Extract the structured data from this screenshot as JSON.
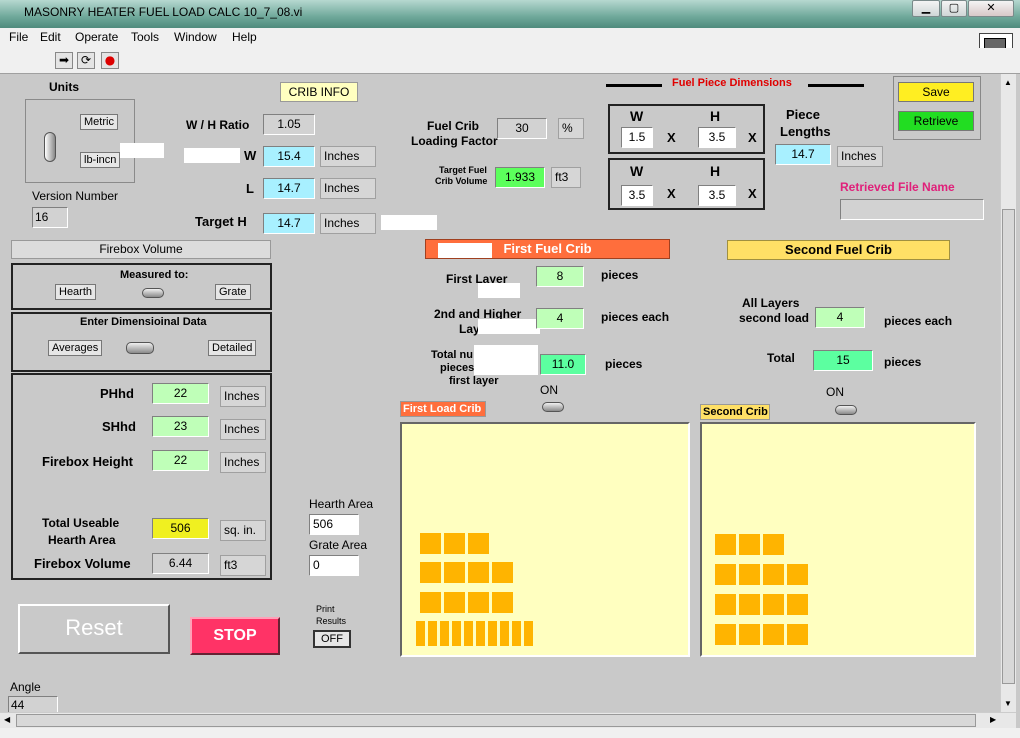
{
  "window": {
    "title": "MASONRY HEATER FUEL LOAD CALC 10_7_08.vi",
    "min": "▁",
    "max": "▢",
    "close": "✕"
  },
  "menu": [
    "File",
    "Edit",
    "Operate",
    "Tools",
    "Window",
    "Help"
  ],
  "units": {
    "title": "Units",
    "metric": "Metric",
    "lbinch": "lb-incn"
  },
  "version": {
    "label": "Version Number",
    "value": "16"
  },
  "crib_info": "CRIB INFO",
  "wh_ratio": {
    "label": "W / H  Ratio",
    "value": "1.05"
  },
  "w": {
    "label": "W",
    "value": "15.4",
    "unit": "Inches"
  },
  "l": {
    "label": "L",
    "value": "14.7",
    "unit": "Inches"
  },
  "target_h": {
    "label": "Target H",
    "value": "14.7",
    "unit": "Inches"
  },
  "loading": {
    "label1": "Fuel Crib",
    "label2": "Loading Factor",
    "value": "30",
    "unit": "%"
  },
  "target_vol": {
    "label1": "Target Fuel",
    "label2": "Crib Volume",
    "value": "1.933",
    "unit": "ft3"
  },
  "fuel_dim": {
    "title": "Fuel Piece Dimensions",
    "w": "W",
    "h": "H",
    "x": "X",
    "r1w": "1.5",
    "r1h": "3.5",
    "r2w": "3.5",
    "r2h": "3.5"
  },
  "piece_len": {
    "label1": "Piece",
    "label2": "Lengths",
    "value": "14.7",
    "unit": "Inches"
  },
  "save": "Save",
  "retrieve": "Retrieve",
  "retrieved_label": "Retrieved File Name",
  "firebox_volume_btn": "Firebox Volume",
  "measured": {
    "title": "Measured to:",
    "hearth": "Hearth",
    "grate": "Grate"
  },
  "enter_dim": {
    "title": "Enter Dimensioinal Data",
    "averages": "Averages",
    "detailed": "Detailed"
  },
  "phhd": {
    "label": "PHhd",
    "value": "22",
    "unit": "Inches"
  },
  "shhd": {
    "label": "SHhd",
    "value": "23",
    "unit": "Inches"
  },
  "fb_height": {
    "label": "Firebox Height",
    "value": "22",
    "unit": "Inches"
  },
  "useable": {
    "label1": "Total Useable",
    "label2": "Hearth Area",
    "value": "506",
    "unit": "sq. in."
  },
  "fb_volume": {
    "label": "Firebox Volume",
    "value": "6.44",
    "unit": "ft3"
  },
  "hearth_area": {
    "label": "Hearth Area",
    "value": "506"
  },
  "grate_area": {
    "label": "Grate Area",
    "value": "0"
  },
  "reset": "Reset",
  "stop": "STOP",
  "print": {
    "label1": "Print",
    "label2": "Results",
    "value": "OFF"
  },
  "first_crib": {
    "title": "First Fuel Crib",
    "first_layer": "First Layer",
    "fl_value": "8",
    "fl_unit": "pieces",
    "second_label1": "2nd and Higher",
    "second_label2": "Lay",
    "second_value": "4",
    "second_unit": "pieces each",
    "total_label1": "Total nu",
    "total_label2": "pieces",
    "total_label3": "first layer",
    "total_value": "11.0",
    "total_unit": "pieces",
    "on": "ON",
    "graph_label": "First Load Crib"
  },
  "second_crib": {
    "title": "Second Fuel Crib",
    "all_label1": "All  Layers",
    "all_label2": "second load",
    "all_value": "4",
    "all_unit": "pieces each",
    "total_label": "Total",
    "total_value": "15",
    "total_unit": "pieces",
    "on": "ON",
    "graph_label": "Second Crib"
  },
  "angle": {
    "label": "Angle",
    "value": "44"
  },
  "colors": {
    "orange_header": "#ff6e3c",
    "yellow_header": "#ffe066",
    "graph_bg": "#ffffc0",
    "block": "#ffb400",
    "stop": "#ff3366"
  }
}
